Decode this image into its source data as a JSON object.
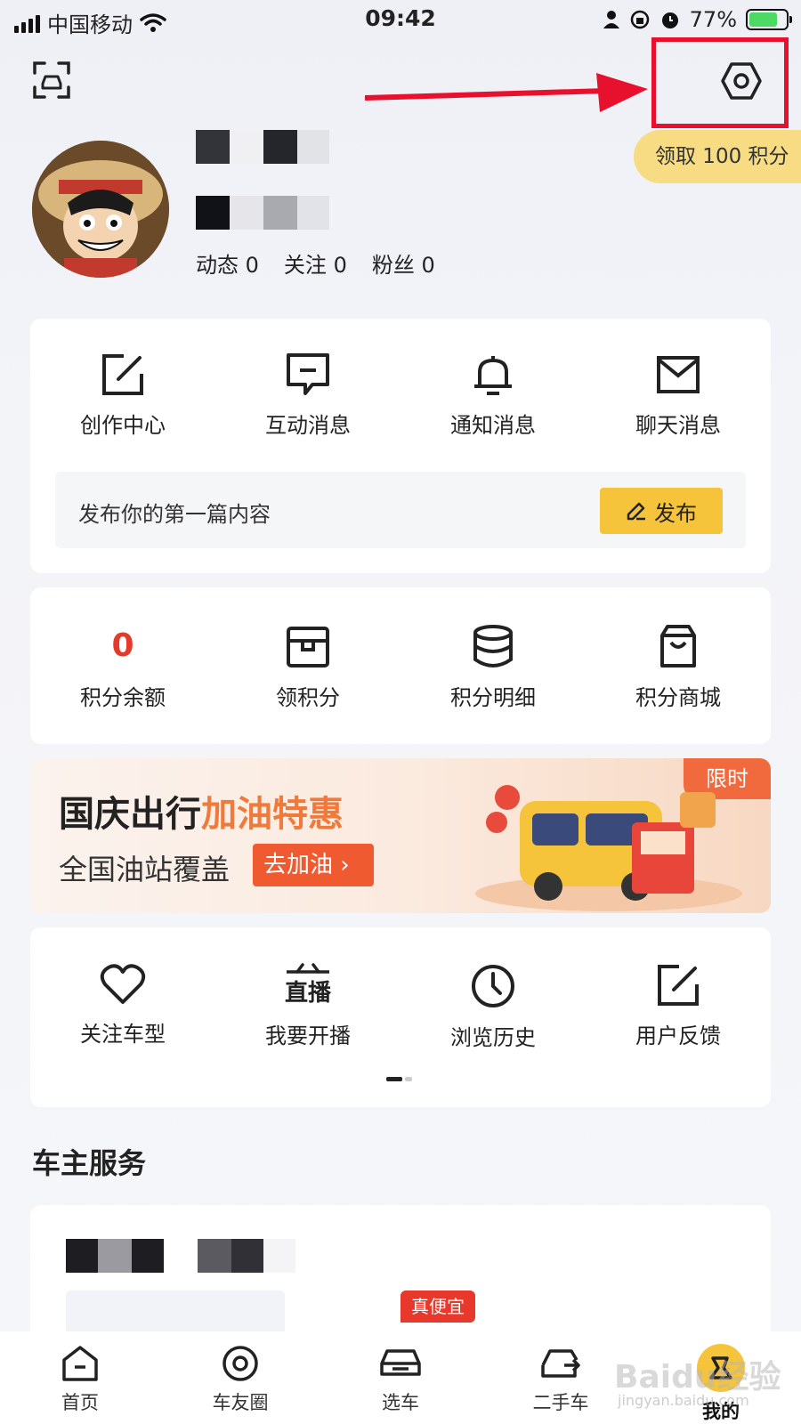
{
  "status_bar": {
    "carrier": "中国移动",
    "time": "09:42",
    "battery": "77%",
    "battery_level": 0.77
  },
  "header": {
    "points_pill": "领取 100 积分"
  },
  "profile": {
    "stats": [
      {
        "label": "动态",
        "value": "0"
      },
      {
        "label": "关注",
        "value": "0"
      },
      {
        "label": "粉丝",
        "value": "0"
      }
    ]
  },
  "creation_card": {
    "items": [
      {
        "label": "创作中心",
        "icon": "edit-icon"
      },
      {
        "label": "互动消息",
        "icon": "comment-icon"
      },
      {
        "label": "通知消息",
        "icon": "bell-icon"
      },
      {
        "label": "聊天消息",
        "icon": "mail-icon"
      }
    ],
    "publish_prompt": "发布你的第一篇内容",
    "publish_button": "发布"
  },
  "points_card": {
    "balance": "0",
    "items": [
      {
        "label": "积分余额"
      },
      {
        "label": "领积分",
        "icon": "box-icon"
      },
      {
        "label": "积分明细",
        "icon": "database-icon"
      },
      {
        "label": "积分商城",
        "icon": "shopping-bag-icon"
      }
    ]
  },
  "banner": {
    "title_prefix": "国庆出行",
    "title_accent": "加油特惠",
    "subtitle": "全国油站覆盖",
    "button": "去加油 ›",
    "badge": "限时"
  },
  "tools_card": {
    "items": [
      {
        "label": "关注车型",
        "icon": "heart-icon"
      },
      {
        "label": "我要开播",
        "icon": "live-icon",
        "icon_text": "直播"
      },
      {
        "label": "浏览历史",
        "icon": "clock-icon"
      },
      {
        "label": "用户反馈",
        "icon": "feedback-icon"
      }
    ]
  },
  "services": {
    "title": "车主服务",
    "promo_tag": "真便宜"
  },
  "tab_bar": {
    "tabs": [
      {
        "label": "首页"
      },
      {
        "label": "车友圈"
      },
      {
        "label": "选车"
      },
      {
        "label": "二手车"
      },
      {
        "label": "我的"
      }
    ]
  },
  "colors": {
    "accent_yellow": "#f6c43b",
    "accent_red": "#e33a2a",
    "annotation_red": "#e8112d",
    "banner_orange": "#f07a3c"
  },
  "watermark": {
    "text": "Baidu经验",
    "sub": "jingyan.baidu.com"
  }
}
